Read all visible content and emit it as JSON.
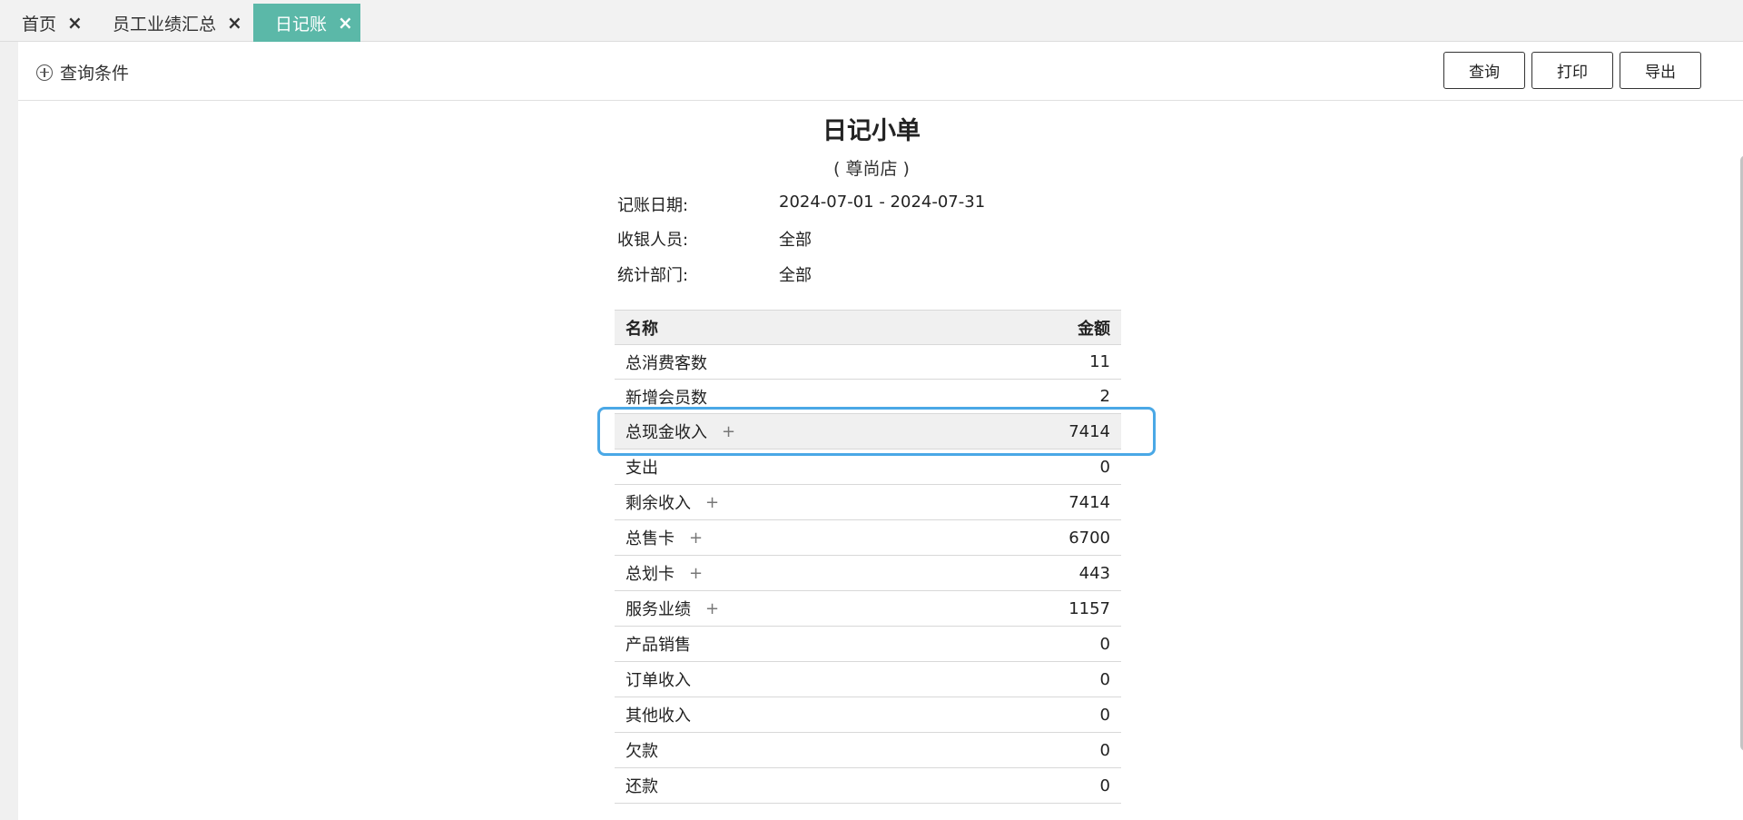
{
  "tabs": [
    {
      "label": "首页",
      "close": "×"
    },
    {
      "label": "员工业绩汇总",
      "close": "×"
    },
    {
      "label": "日记账",
      "close": "×"
    }
  ],
  "toolbar": {
    "query_toggle": "查询条件",
    "query_btn": "查询",
    "print_btn": "打印",
    "export_btn": "导出"
  },
  "report": {
    "title": "日记小单",
    "store": "( 尊尚店 )",
    "date_label": "记账日期:",
    "date_value": "2024-07-01 - 2024-07-31",
    "cashier_label": "收银人员:",
    "cashier_value": "全部",
    "dept_label": "统计部门:",
    "dept_value": "全部",
    "col_name": "名称",
    "col_amount": "金额",
    "rows": [
      {
        "name": "总消费客数",
        "amount": "11",
        "expandable": false
      },
      {
        "name": "新增会员数",
        "amount": "2",
        "expandable": false
      },
      {
        "name": "总现金收入",
        "amount": "7414",
        "expandable": true
      },
      {
        "name": "支出",
        "amount": "0",
        "expandable": false
      },
      {
        "name": "剩余收入",
        "amount": "7414",
        "expandable": true
      },
      {
        "name": "总售卡",
        "amount": "6700",
        "expandable": true
      },
      {
        "name": "总划卡",
        "amount": "443",
        "expandable": true
      },
      {
        "name": "服务业绩",
        "amount": "1157",
        "expandable": true
      },
      {
        "name": "产品销售",
        "amount": "0",
        "expandable": false
      },
      {
        "name": "订单收入",
        "amount": "0",
        "expandable": false
      },
      {
        "name": "其他收入",
        "amount": "0",
        "expandable": false
      },
      {
        "name": "欠款",
        "amount": "0",
        "expandable": false
      },
      {
        "name": "还款",
        "amount": "0",
        "expandable": false
      }
    ],
    "expand_symbol": "+"
  },
  "colors": {
    "active_tab": "#5bb8a8",
    "highlight": "#4aa8e6"
  }
}
